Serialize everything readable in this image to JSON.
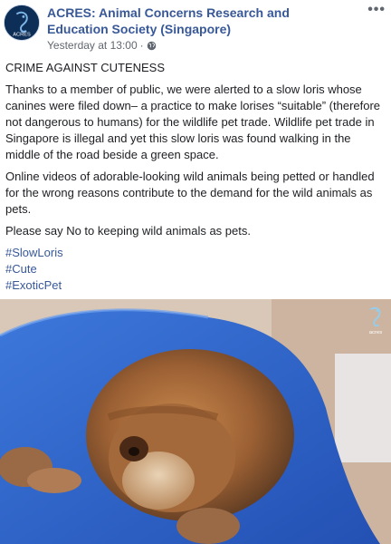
{
  "header": {
    "page_name": "ACRES: Animal Concerns Research and Education Society (Singapore)",
    "timestamp": "Yesterday at 13:00",
    "privacy_icon": "globe-icon",
    "more_icon": "more-options-icon",
    "avatar_text": "ACRES"
  },
  "post": {
    "heading": "CRIME AGAINST CUTENESS",
    "paragraphs": [
      "Thanks to a member of public, we were alerted to a slow loris whose canines were filed down– a practice to make lorises “suitable” (therefore not dangerous to humans) for the wildlife pet trade. Wildlife pet trade in Singapore is illegal and yet this slow loris was found walking in the middle of the road beside a green space.",
      "Online videos of adorable-looking wild animals being petted or handled for the wrong reasons contribute to the demand for the wild animals as pets.",
      "Please say No to keeping wild animals as pets."
    ],
    "hashtags": [
      "#SlowLoris",
      "#Cute",
      "#ExoticPet"
    ]
  },
  "photo": {
    "watermark_text": "acres"
  },
  "colors": {
    "link": "#385898",
    "brand_navy": "#0d2e57",
    "towel_blue": "#2f63c9"
  }
}
